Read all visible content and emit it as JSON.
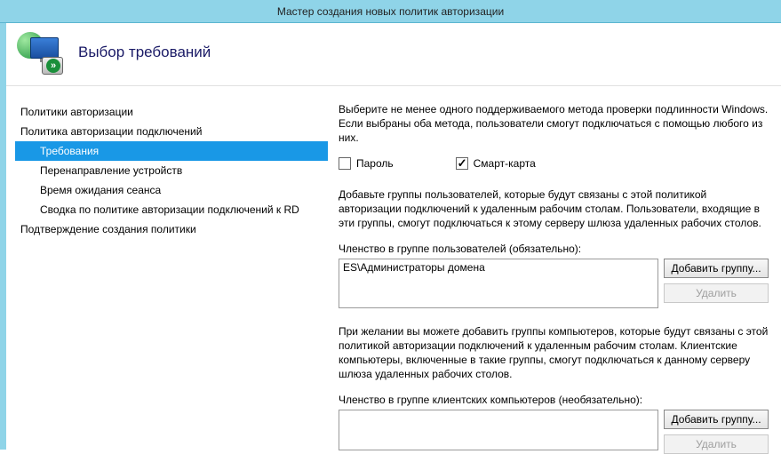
{
  "window": {
    "title": "Мастер создания новых политик авторизации"
  },
  "header": {
    "title": "Выбор требований"
  },
  "nav": {
    "items": [
      {
        "label": "Политики авторизации",
        "depth": 0,
        "selected": false
      },
      {
        "label": "Политика авторизации подключений",
        "depth": 0,
        "selected": false
      },
      {
        "label": "Требования",
        "depth": 1,
        "selected": true
      },
      {
        "label": "Перенаправление устройств",
        "depth": 1,
        "selected": false
      },
      {
        "label": "Время ожидания сеанса",
        "depth": 1,
        "selected": false
      },
      {
        "label": "Сводка по политике авторизации подключений к RD",
        "depth": 1,
        "selected": false
      },
      {
        "label": "Подтверждение создания политики",
        "depth": 0,
        "selected": false
      }
    ]
  },
  "main": {
    "auth_instruction": "Выберите не менее одного поддерживаемого метода проверки подлинности Windows. Если выбраны оба метода, пользователи смогут подключаться с помощью любого из них.",
    "password_label": "Пароль",
    "password_checked": false,
    "smartcard_label": "Смарт-карта",
    "smartcard_checked": true,
    "users_instruction": "Добавьте группы пользователей, которые будут связаны с этой политикой авторизации подключений к удаленным рабочим столам. Пользователи, входящие в эти группы, смогут подключаться к этому серверу шлюза удаленных рабочих столов.",
    "users_section_label": "Членство в группе пользователей (обязательно):",
    "users_list": "ES\\Администраторы домена",
    "computers_instruction": "При желании вы можете добавить группы компьютеров, которые будут связаны с этой политикой авторизации подключений к удаленным рабочим столам. Клиентские компьютеры, включенные в такие группы, смогут подключаться к данному серверу шлюза удаленных рабочих столов.",
    "computers_section_label": "Членство в группе клиентских компьютеров (необязательно):",
    "computers_list": "",
    "add_button": "Добавить группу...",
    "remove_button": "Удалить"
  }
}
